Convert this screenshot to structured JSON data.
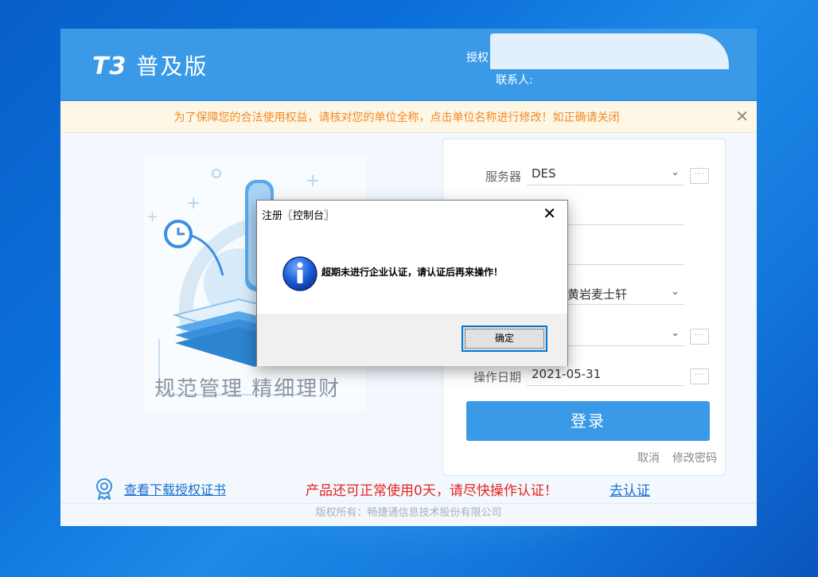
{
  "app": {
    "logo_mark": "T3",
    "logo_name": "普及版",
    "auth_label": "授权",
    "contact_label": "联系人:"
  },
  "notice": {
    "text": "为了保障您的合法使用权益，请核对您的单位全称，点击单位名称进行修改！如正确请关闭",
    "close": "✕"
  },
  "left": {
    "slogan": "规范管理  精细理财"
  },
  "login": {
    "server_label": "服务器",
    "server_value": "DES",
    "company_value": "台州市黄岩麦士轩",
    "date_label": "操作日期",
    "date_value": "2021-05-31",
    "login_button": "登录",
    "cancel_link": "取消",
    "change_password_link": "修改密码",
    "dots": "···"
  },
  "bottom": {
    "cert_link": "查看下载授权证书",
    "warning": "产品还可正常使用0天，请尽快操作认证！",
    "go_auth_link": "去认证"
  },
  "footer": {
    "copyright": "版权所有：畅捷通信息技术股份有限公司"
  },
  "dialog": {
    "title": "注册〖控制台〗",
    "message": "超期未进行企业认证，请认证后再来操作！",
    "ok_button": "确定",
    "close": "✕"
  },
  "colors": {
    "brand_blue": "#3b9ae8",
    "warning_red": "#e8231f",
    "notice_orange": "#f08a28",
    "link_blue": "#1a6ed0"
  }
}
